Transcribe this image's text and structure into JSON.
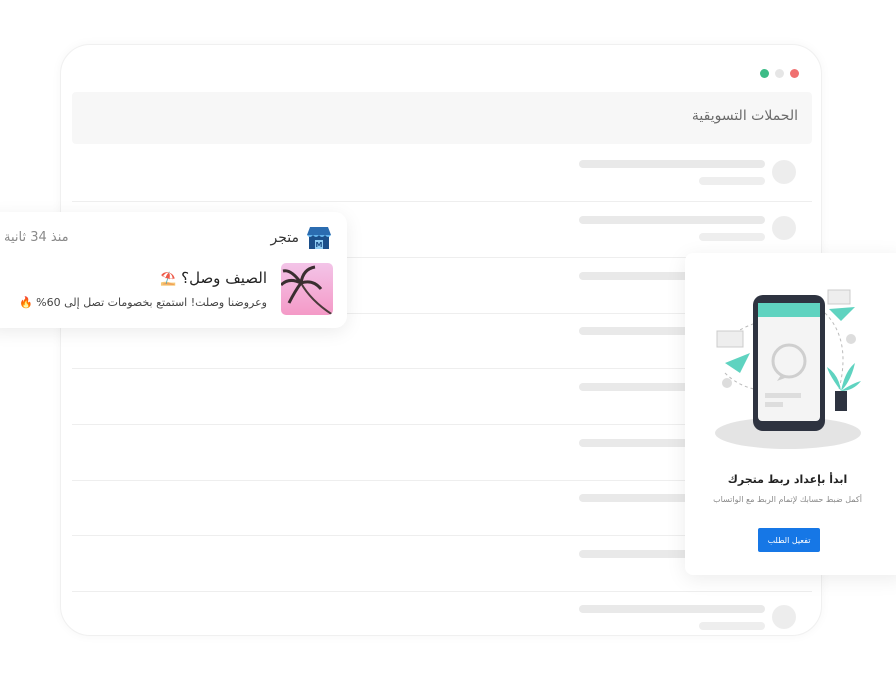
{
  "window": {
    "header_title": "الحملات التسويقية"
  },
  "notification": {
    "store_name": "متجر",
    "time": "منذ 34 ثانية",
    "title": "الصيف وصل؟",
    "title_emoji": "⛱️",
    "body": "وعروضنا وصلت! استمتع بخصومات تصل إلى 60% 🔥",
    "store_icon": "store-icon",
    "thumb_icon": "palm-tree-image"
  },
  "whatsapp_setup": {
    "title": "ابدأ بإعداد ربط متجرك",
    "subtitle": "أكمل ضبط حسابك لإتمام الربط مع الواتساب",
    "button_label": "تفعيل الطلب",
    "illustration": "phone-whatsapp-illustration"
  },
  "colors": {
    "accent_blue": "#1677e6",
    "teal": "#5fd3c0",
    "dot_green": "#3dbc87",
    "dot_red": "#f07070"
  }
}
